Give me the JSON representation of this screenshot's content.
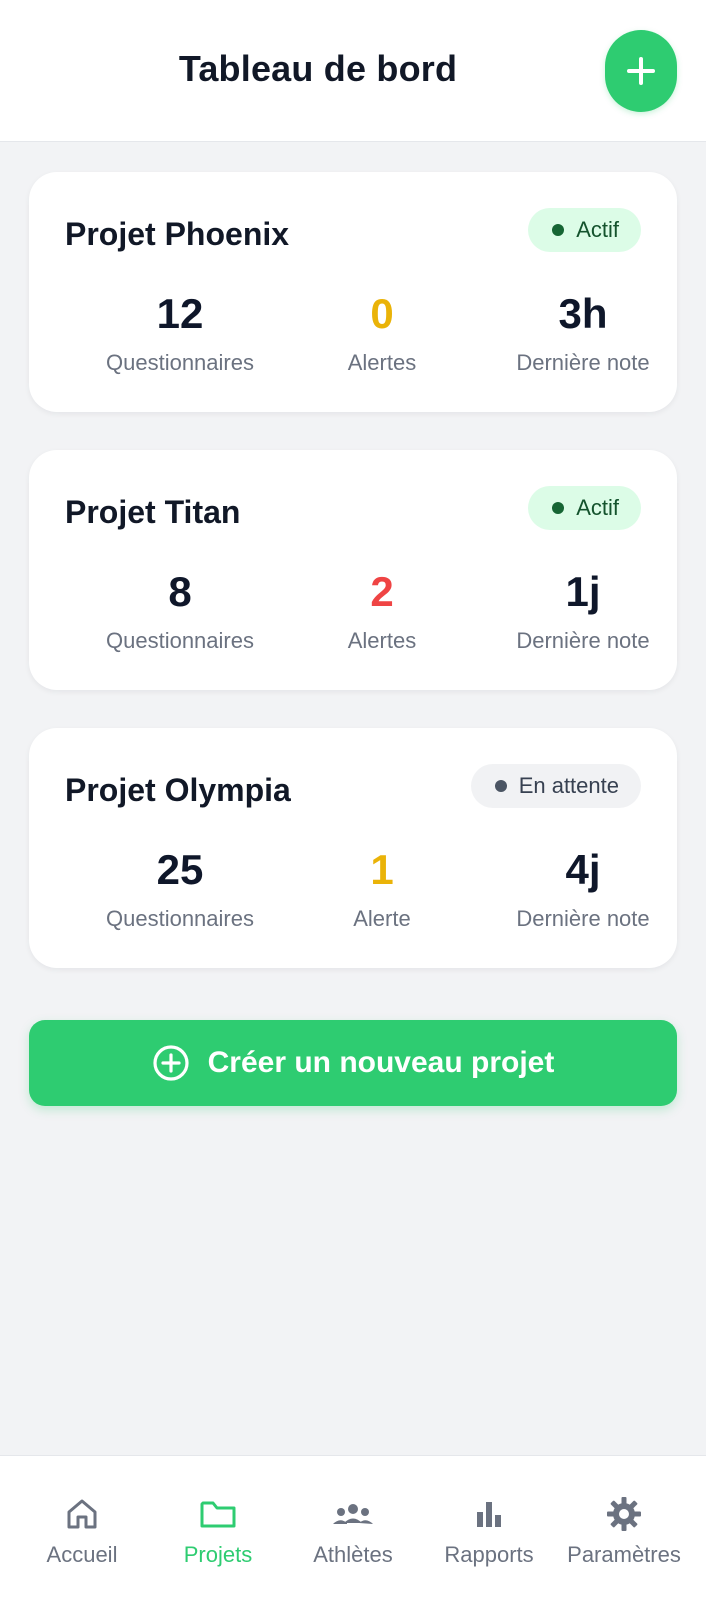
{
  "header": {
    "title": "Tableau de bord",
    "add_icon": "plus-icon"
  },
  "projects": [
    {
      "name": "Projet Phoenix",
      "status": "Actif",
      "status_type": "active",
      "stats": [
        {
          "value": "12",
          "label": "Questionnaires",
          "color": "#0f172a"
        },
        {
          "value": "0",
          "label": "Alertes",
          "color": "#eab308"
        },
        {
          "value": "3h",
          "label": "Dernière note",
          "color": "#0f172a"
        }
      ]
    },
    {
      "name": "Projet Titan",
      "status": "Actif",
      "status_type": "active",
      "stats": [
        {
          "value": "8",
          "label": "Questionnaires",
          "color": "#0f172a"
        },
        {
          "value": "2",
          "label": "Alertes",
          "color": "#ef4444"
        },
        {
          "value": "1j",
          "label": "Dernière note",
          "color": "#0f172a"
        }
      ]
    },
    {
      "name": "Projet Olympia",
      "status": "En attente",
      "status_type": "pending",
      "stats": [
        {
          "value": "25",
          "label": "Questionnaires",
          "color": "#0f172a"
        },
        {
          "value": "1",
          "label": "Alerte",
          "color": "#eab308"
        },
        {
          "value": "4j",
          "label": "Dernière note",
          "color": "#0f172a"
        }
      ]
    }
  ],
  "create_button": {
    "label": "Créer un nouveau projet",
    "icon": "plus-circle-icon"
  },
  "bottom_nav": {
    "active": "Projets",
    "items": [
      {
        "label": "Accueil",
        "icon": "home-icon"
      },
      {
        "label": "Projets",
        "icon": "folder-icon"
      },
      {
        "label": "Athlètes",
        "icon": "users-icon"
      },
      {
        "label": "Rapports",
        "icon": "bar-chart-icon"
      },
      {
        "label": "Paramètres",
        "icon": "gear-icon"
      }
    ]
  },
  "colors": {
    "accent": "#2ecc71",
    "active_badge_bg": "#dcfce7",
    "pending_badge_bg": "#f1f2f4",
    "alert_yellow": "#eab308",
    "alert_red": "#ef4444"
  }
}
